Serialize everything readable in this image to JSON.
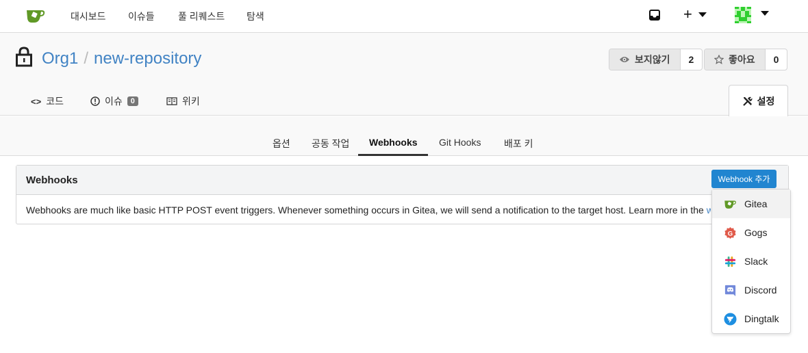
{
  "nav": {
    "items": [
      "대시보드",
      "이슈들",
      "풀 리퀘스트",
      "탐색"
    ]
  },
  "repo": {
    "owner": "Org1",
    "separator": "/",
    "name": "new-repository",
    "watch_label": "보지않기",
    "watch_count": "2",
    "star_label": "좋아요",
    "star_count": "0"
  },
  "tabs": {
    "code": "코드",
    "issues": "이슈",
    "issues_count": "0",
    "wiki": "위키",
    "settings": "설정"
  },
  "submenu": [
    "옵션",
    "공동 작업",
    "Webhooks",
    "Git Hooks",
    "배포 키"
  ],
  "panel": {
    "title": "Webhooks",
    "add_button": "Webhook 추가",
    "description": "Webhooks are much like basic HTTP POST event triggers. Whenever something occurs in Gitea, we will send a notification to the target host. Learn more in the ",
    "link_fragment": "w"
  },
  "dropdown": {
    "items": [
      {
        "label": "Gitea",
        "icon": "gitea-icon"
      },
      {
        "label": "Gogs",
        "icon": "gogs-icon"
      },
      {
        "label": "Slack",
        "icon": "slack-icon"
      },
      {
        "label": "Discord",
        "icon": "discord-icon"
      },
      {
        "label": "Dingtalk",
        "icon": "dingtalk-icon"
      }
    ]
  },
  "colors": {
    "link": "#4183c4",
    "primary_button": "#2185d0",
    "gitea_green": "#609926"
  }
}
